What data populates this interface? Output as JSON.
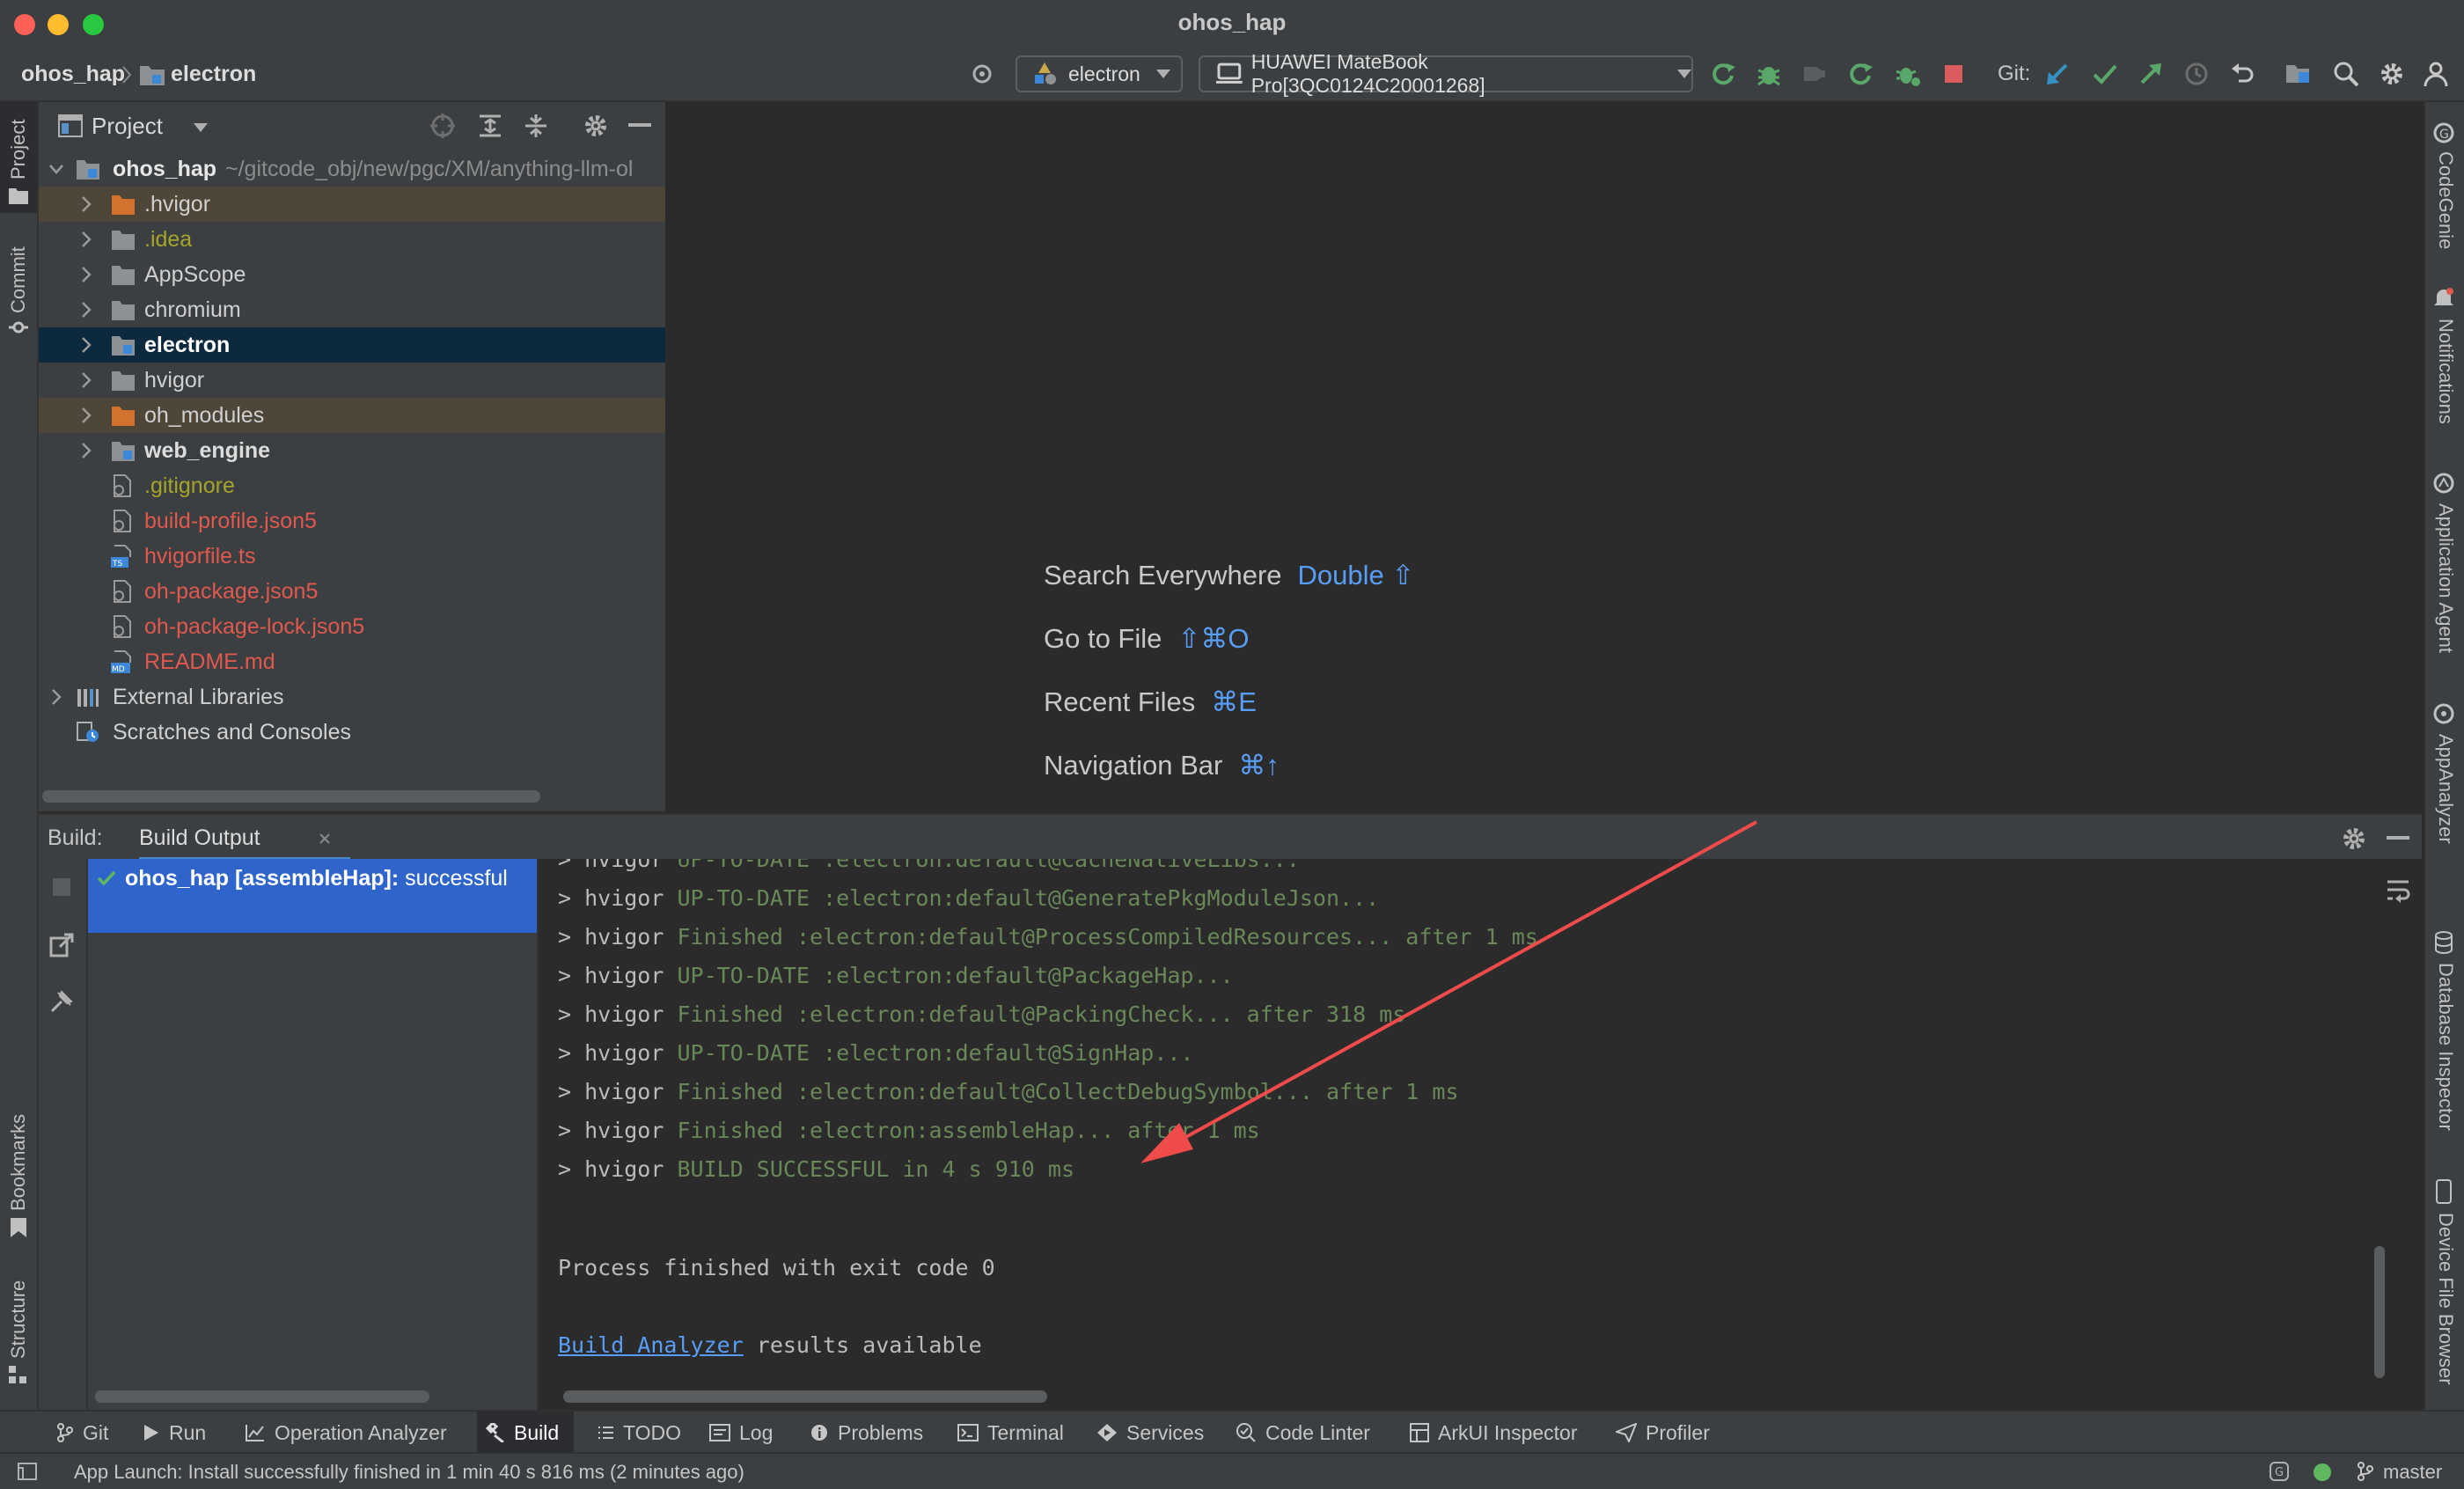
{
  "window": {
    "title": "ohos_hap"
  },
  "navbar": {
    "breadcrumb": [
      "ohos_hap",
      "electron"
    ],
    "run_config": "electron",
    "device": "HUAWEI MateBook Pro[3QC0124C20001268]",
    "git_label": "Git:"
  },
  "left_tools": {
    "project": "Project",
    "commit": "Commit",
    "bookmarks": "Bookmarks",
    "structure": "Structure"
  },
  "right_tools": {
    "codegenie": "CodeGenie",
    "notifications": "Notifications",
    "application_agent": "Application Agent",
    "appanalyzer": "AppAnalyzer",
    "database_inspector": "Database Inspector",
    "device_file_browser": "Device File Browser"
  },
  "project_panel": {
    "title": "Project",
    "root_name": "ohos_hap",
    "root_path": "~/gitcode_obj/new/pgc/XM/anything-llm-ol",
    "items": [
      {
        "label": ".hvigor",
        "kind": "folder-excluded",
        "color": "#d0d0d0"
      },
      {
        "label": ".idea",
        "kind": "folder",
        "color": "#a5a52a"
      },
      {
        "label": "AppScope",
        "kind": "folder",
        "color": "#d0d0d0"
      },
      {
        "label": "chromium",
        "kind": "folder",
        "color": "#d0d0d0"
      },
      {
        "label": "electron",
        "kind": "module",
        "color": "#ffffff"
      },
      {
        "label": "hvigor",
        "kind": "folder",
        "color": "#d0d0d0"
      },
      {
        "label": "oh_modules",
        "kind": "folder-excluded",
        "color": "#d0d0d0"
      },
      {
        "label": "web_engine",
        "kind": "module",
        "color": "#dcdcdc"
      },
      {
        "label": ".gitignore",
        "kind": "file",
        "color": "#a5a52a"
      },
      {
        "label": "build-profile.json5",
        "kind": "file",
        "color": "#e0584e"
      },
      {
        "label": "hvigorfile.ts",
        "kind": "ts",
        "color": "#e0584e"
      },
      {
        "label": "oh-package.json5",
        "kind": "file",
        "color": "#e0584e"
      },
      {
        "label": "oh-package-lock.json5",
        "kind": "file",
        "color": "#e0584e"
      },
      {
        "label": "README.md",
        "kind": "md",
        "color": "#e0584e"
      }
    ],
    "external_libraries": "External Libraries",
    "scratches": "Scratches and Consoles"
  },
  "editor_hints": [
    {
      "label": "Search Everywhere",
      "key": "Double ⇧"
    },
    {
      "label": "Go to File",
      "key": "⇧⌘O"
    },
    {
      "label": "Recent Files",
      "key": "⌘E"
    },
    {
      "label": "Navigation Bar",
      "key": "⌘↑"
    }
  ],
  "build_panel": {
    "label": "Build:",
    "tab": "Build Output",
    "tree_item": "ohos_hap [assembleHap]: successful",
    "tree_item_bold": "ohos_hap [assembleHap]:",
    "tree_item_rest": " successful",
    "console": [
      {
        "prefix": "> hvigor ",
        "status": "UP-TO-DATE",
        "rest": " :electron:default@CacheNativeLibs..."
      },
      {
        "prefix": "> hvigor ",
        "status": "UP-TO-DATE",
        "rest": " :electron:default@GeneratePkgModuleJson..."
      },
      {
        "prefix": "> hvigor ",
        "status": "Finished",
        "rest": " :electron:default@ProcessCompiledResources... after 1 ms"
      },
      {
        "prefix": "> hvigor ",
        "status": "UP-TO-DATE",
        "rest": " :electron:default@PackageHap..."
      },
      {
        "prefix": "> hvigor ",
        "status": "Finished",
        "rest": " :electron:default@PackingCheck... after 318 ms"
      },
      {
        "prefix": "> hvigor ",
        "status": "UP-TO-DATE",
        "rest": " :electron:default@SignHap..."
      },
      {
        "prefix": "> hvigor ",
        "status": "Finished",
        "rest": " :electron:default@CollectDebugSymbol... after 1 ms"
      },
      {
        "prefix": "> hvigor ",
        "status": "Finished",
        "rest": " :electron:assembleHap... after 1 ms"
      },
      {
        "prefix": "> hvigor ",
        "status": "BUILD SUCCESSFUL",
        "rest": " in 4 s 910 ms"
      }
    ],
    "exit_line": "Process finished with exit code 0",
    "analyzer_link": "Build Analyzer",
    "analyzer_rest": " results available"
  },
  "bottom_tabs": [
    "Git",
    "Run",
    "Operation Analyzer",
    "Build",
    "TODO",
    "Log",
    "Problems",
    "Terminal",
    "Services",
    "Code Linter",
    "ArkUI Inspector",
    "Profiler"
  ],
  "status_bar": {
    "message": "App Launch: Install successfully finished in 1 min 40 s 816 ms (2 minutes ago)",
    "branch": "master"
  },
  "colors": {
    "accent": "#589df6",
    "success": "#5fb85f",
    "error": "#e0584e",
    "selection": "#0d293e",
    "arrow": "#ef4b4b"
  }
}
